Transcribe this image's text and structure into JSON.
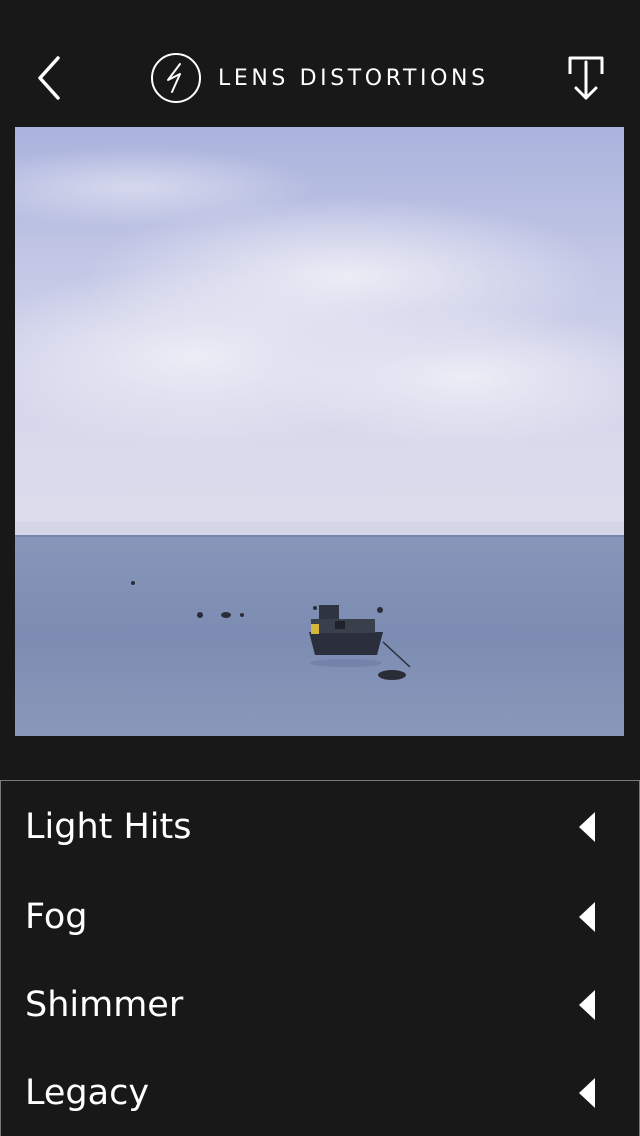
{
  "header": {
    "title": "LENS DISTORTIONS",
    "back_icon": "chevron-left-icon",
    "logo_icon": "lens-distortions-logo",
    "download_icon": "download-icon"
  },
  "photo": {
    "subject": "boat-on-sea"
  },
  "menu": {
    "items": [
      {
        "label": "Light Hits",
        "icon": "triangle-left-icon"
      },
      {
        "label": "Fog",
        "icon": "triangle-left-icon"
      },
      {
        "label": "Shimmer",
        "icon": "triangle-left-icon"
      },
      {
        "label": "Legacy",
        "icon": "triangle-left-icon"
      }
    ]
  },
  "colors": {
    "background": "#181818",
    "text": "#ffffff",
    "divider": "#7a7a7a"
  }
}
